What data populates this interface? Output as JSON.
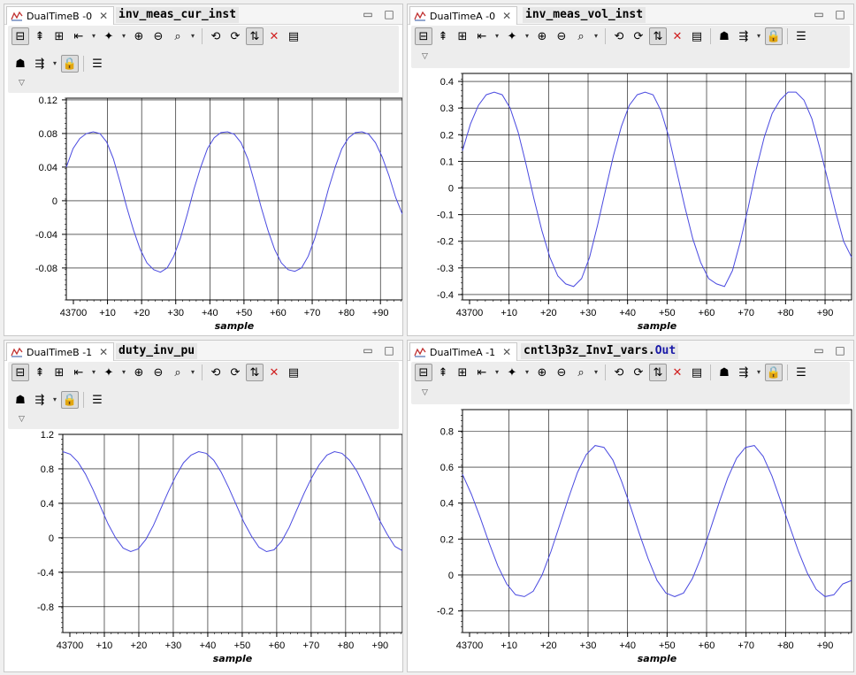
{
  "panels": [
    {
      "tab_title": "DualTimeB -0",
      "expression": {
        "main": "inv_meas_cur_inst",
        "field": ""
      },
      "window_controls": {
        "minimize": "▭",
        "maximize": "□"
      },
      "toolbar_overflow": "▽",
      "chart_data": {
        "type": "line",
        "xlabel": "sample",
        "x_start": 43700,
        "x_ticks": [
          "43700",
          "+10",
          "+20",
          "+30",
          "+40",
          "+50",
          "+60",
          "+70",
          "+80",
          "+90"
        ],
        "y_ticks": [
          "0.12",
          "0.08",
          "0.04",
          "0",
          "-0.04",
          "-0.08"
        ],
        "ylim": [
          -0.118,
          0.122
        ],
        "grid": true,
        "series": [
          {
            "color": "#4a4ae0",
            "values": [
              0.04,
              0.062,
              0.074,
              0.08,
              0.082,
              0.08,
              0.07,
              0.05,
              0.022,
              -0.008,
              -0.035,
              -0.058,
              -0.074,
              -0.082,
              -0.085,
              -0.08,
              -0.066,
              -0.044,
              -0.016,
              0.014,
              0.04,
              0.062,
              0.075,
              0.081,
              0.082,
              0.079,
              0.069,
              0.05,
              0.022,
              -0.008,
              -0.035,
              -0.058,
              -0.074,
              -0.082,
              -0.084,
              -0.08,
              -0.066,
              -0.044,
              -0.016,
              0.014,
              0.04,
              0.062,
              0.075,
              0.081,
              0.082,
              0.079,
              0.069,
              0.052,
              0.03,
              0.004,
              -0.016
            ]
          }
        ]
      }
    },
    {
      "tab_title": "DualTimeA -0",
      "expression": {
        "main": "inv_meas_vol_inst",
        "field": ""
      },
      "window_controls": {
        "minimize": "▭",
        "maximize": "□"
      },
      "toolbar_overflow": "▽",
      "chart_data": {
        "type": "line",
        "xlabel": "sample",
        "x_start": 43700,
        "x_ticks": [
          "43700",
          "+10",
          "+20",
          "+30",
          "+40",
          "+50",
          "+60",
          "+70",
          "+80",
          "+90"
        ],
        "y_ticks": [
          "0.4",
          "0.3",
          "0.2",
          "0.1",
          "0",
          "-0.1",
          "-0.2",
          "-0.3",
          "-0.4"
        ],
        "ylim": [
          -0.42,
          0.43
        ],
        "grid": true,
        "series": [
          {
            "color": "#4a4ae0",
            "values": [
              0.14,
              0.24,
              0.31,
              0.35,
              0.36,
              0.35,
              0.3,
              0.21,
              0.09,
              -0.04,
              -0.16,
              -0.26,
              -0.33,
              -0.36,
              -0.37,
              -0.34,
              -0.26,
              -0.14,
              -0.01,
              0.12,
              0.23,
              0.31,
              0.35,
              0.36,
              0.35,
              0.29,
              0.19,
              0.06,
              -0.07,
              -0.19,
              -0.28,
              -0.34,
              -0.36,
              -0.37,
              -0.31,
              -0.2,
              -0.07,
              0.07,
              0.19,
              0.28,
              0.33,
              0.36,
              0.36,
              0.33,
              0.26,
              0.15,
              0.03,
              -0.09,
              -0.2,
              -0.26
            ]
          }
        ]
      }
    },
    {
      "tab_title": "DualTimeB -1",
      "expression": {
        "main": "duty_inv_pu",
        "field": ""
      },
      "window_controls": {
        "minimize": "▭",
        "maximize": "□"
      },
      "toolbar_overflow": "▽",
      "chart_data": {
        "type": "line",
        "xlabel": "sample",
        "x_start": 43700,
        "x_ticks": [
          "43700",
          "+10",
          "+20",
          "+30",
          "+40",
          "+50",
          "+60",
          "+70",
          "+80",
          "+90"
        ],
        "y_ticks": [
          "1.2",
          "0.8",
          "0.4",
          "0",
          "-0.4",
          "-0.8"
        ],
        "ylim": [
          -1.1,
          1.2
        ],
        "grid": true,
        "series": [
          {
            "color": "#4a4ae0",
            "values": [
              1.0,
              0.97,
              0.88,
              0.74,
              0.56,
              0.36,
              0.16,
              0.0,
              -0.12,
              -0.16,
              -0.13,
              -0.02,
              0.14,
              0.34,
              0.54,
              0.72,
              0.87,
              0.96,
              1.0,
              0.98,
              0.9,
              0.76,
              0.58,
              0.38,
              0.18,
              0.02,
              -0.11,
              -0.16,
              -0.14,
              -0.04,
              0.12,
              0.32,
              0.52,
              0.7,
              0.85,
              0.96,
              1.0,
              0.98,
              0.9,
              0.77,
              0.59,
              0.4,
              0.2,
              0.04,
              -0.1,
              -0.15
            ]
          }
        ]
      }
    },
    {
      "tab_title": "DualTimeA -1",
      "expression": {
        "main": "cntl3p3z_InvI_vars.",
        "field": "Out"
      },
      "window_controls": {
        "minimize": "▭",
        "maximize": "□"
      },
      "toolbar_overflow": "▽",
      "chart_data": {
        "type": "line",
        "xlabel": "sample",
        "x_start": 43700,
        "x_ticks": [
          "43700",
          "+10",
          "+20",
          "+30",
          "+40",
          "+50",
          "+60",
          "+70",
          "+80",
          "+90"
        ],
        "y_ticks": [
          "0.8",
          "0.6",
          "0.4",
          "0.2",
          "0",
          "-0.2"
        ],
        "ylim": [
          -0.32,
          0.92
        ],
        "grid": true,
        "series": [
          {
            "color": "#4a4ae0",
            "values": [
              0.56,
              0.45,
              0.32,
              0.18,
              0.05,
              -0.05,
              -0.11,
              -0.12,
              -0.09,
              0.0,
              0.13,
              0.28,
              0.43,
              0.57,
              0.67,
              0.72,
              0.71,
              0.64,
              0.52,
              0.38,
              0.23,
              0.09,
              -0.03,
              -0.1,
              -0.12,
              -0.1,
              -0.02,
              0.1,
              0.25,
              0.4,
              0.54,
              0.65,
              0.71,
              0.72,
              0.66,
              0.55,
              0.41,
              0.27,
              0.13,
              0.01,
              -0.08,
              -0.12,
              -0.11,
              -0.05,
              -0.03
            ]
          }
        ]
      }
    }
  ],
  "toolbar": {
    "row1_left": [
      "⊟",
      "⇞",
      "⊞",
      "⇤",
      "✦",
      "⊕",
      "⊖",
      "⌕"
    ],
    "row1_right_b": [
      "⟲",
      "⟳",
      "⇅",
      "✕",
      "▤"
    ],
    "row2_b": [
      "☗",
      "⇶",
      "🔒",
      "☰"
    ],
    "row1_right_a": [
      "⟲",
      "⟳",
      "⇅",
      "✕",
      "▤",
      "☗",
      "⇶",
      "🔒",
      "☰"
    ],
    "dropdown": "▾"
  },
  "icon_names": [
    "graph-icon",
    "close-icon"
  ]
}
